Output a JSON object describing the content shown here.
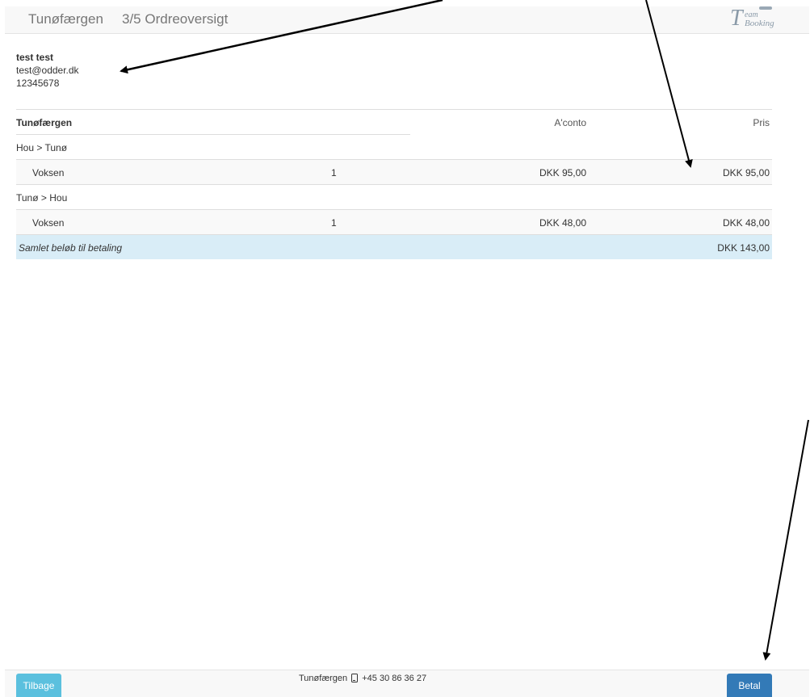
{
  "header": {
    "brand": "Tunøfærgen",
    "step": "3/5 Ordreoversigt",
    "logo_big": "T",
    "logo_line1": "eam",
    "logo_line2": "Booking"
  },
  "customer": {
    "name": "test test",
    "email": "test@odder.dk",
    "phone": "12345678"
  },
  "summary": {
    "headers": {
      "label": "Tunøfærgen",
      "aconto": "A'conto",
      "price": "Pris"
    },
    "sections": [
      {
        "route": "Hou > Tunø",
        "items": [
          {
            "label": "Voksen",
            "qty": "1",
            "aconto": "DKK 95,00",
            "price": "DKK 95,00"
          }
        ]
      },
      {
        "route": "Tunø > Hou",
        "items": [
          {
            "label": "Voksen",
            "qty": "1",
            "aconto": "DKK 48,00",
            "price": "DKK 48,00"
          }
        ]
      }
    ],
    "total_label": "Samlet beløb til betaling",
    "total_value": "DKK 143,00"
  },
  "footer": {
    "back_label": "Tilbage",
    "pay_label": "Betal",
    "contact_name": "Tunøfærgen",
    "contact_phone": "+45 30 86 36 27"
  },
  "colors": {
    "back_button": "#5bc0de",
    "pay_button": "#337ab7",
    "total_row": "#d9edf7"
  },
  "icons": [
    "mobile-phone-icon"
  ]
}
